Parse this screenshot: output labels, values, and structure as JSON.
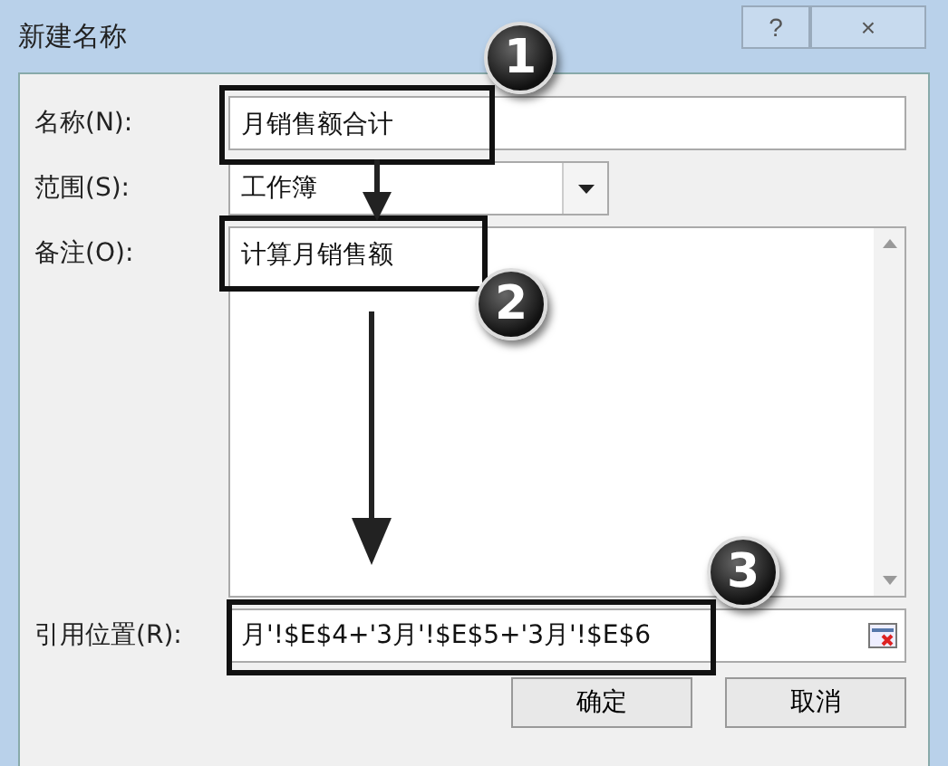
{
  "window": {
    "title": "新建名称",
    "help_button": "?",
    "close_button": "×"
  },
  "fields": [
    {
      "kind": "text",
      "label": "名称(N):",
      "value": "月销售额合计"
    },
    {
      "kind": "combo",
      "label": "范围(S):",
      "value": "工作簿"
    },
    {
      "kind": "memo",
      "label": "备注(O):",
      "value": "计算月销售额"
    },
    {
      "kind": "ref",
      "label": "引用位置(R):",
      "value": "月'!$E$4+'3月'!$E$5+'3月'!$E$6"
    }
  ],
  "buttons": [
    "确定",
    "取消"
  ],
  "callouts": [
    {
      "number": "1"
    },
    {
      "number": "2"
    },
    {
      "number": "3"
    }
  ]
}
